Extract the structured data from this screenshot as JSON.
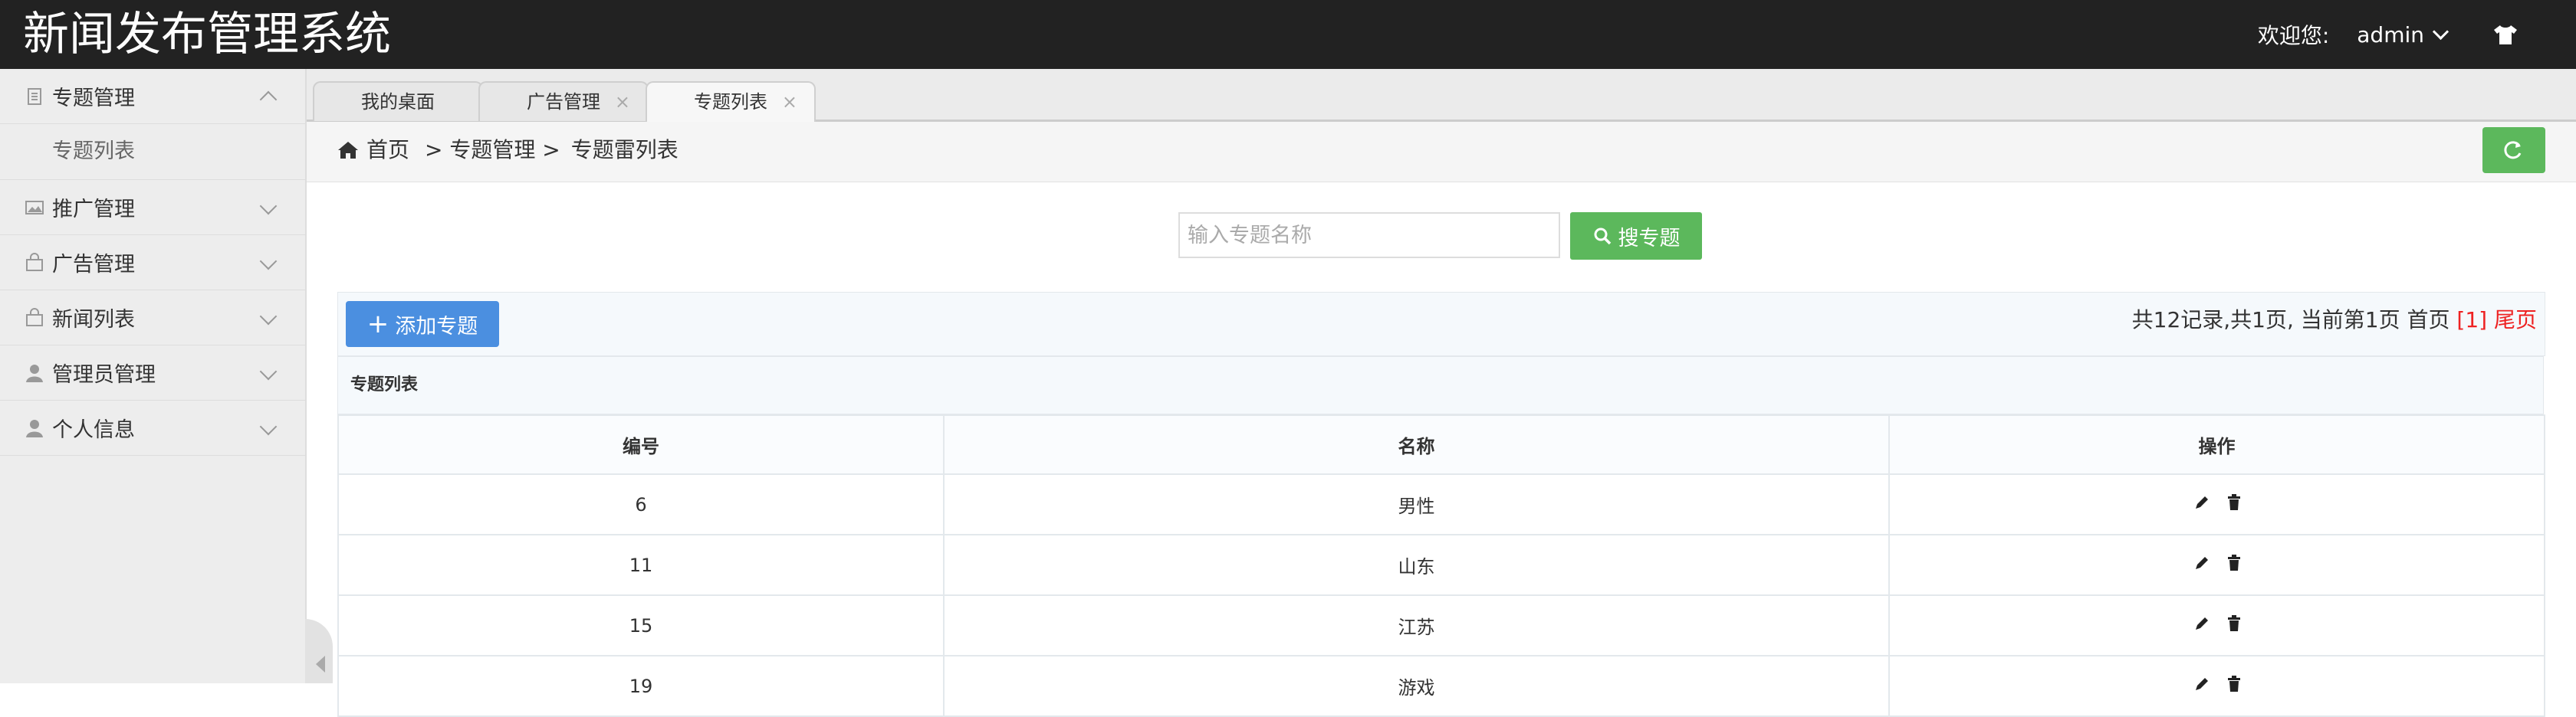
{
  "header": {
    "title": "新闻发布管理系统",
    "welcome": "欢迎您:",
    "user": "admin",
    "user_menu_icon": "chevron-down-icon",
    "theme_icon": "shirt-icon"
  },
  "sidebar": {
    "items": [
      {
        "label": "专题管理",
        "icon": "document-icon",
        "expanded": true,
        "children": [
          "专题列表"
        ]
      },
      {
        "label": "推广管理",
        "icon": "image-icon",
        "expanded": false
      },
      {
        "label": "广告管理",
        "icon": "bag-icon",
        "expanded": false
      },
      {
        "label": "新闻列表",
        "icon": "bag-icon",
        "expanded": false
      },
      {
        "label": "管理员管理",
        "icon": "user-icon",
        "expanded": false
      },
      {
        "label": "个人信息",
        "icon": "user-icon",
        "expanded": false
      }
    ]
  },
  "tabs": [
    {
      "label": "我的桌面",
      "closable": false
    },
    {
      "label": "广告管理",
      "closable": true,
      "close": "×"
    },
    {
      "label": "专题列表",
      "closable": true,
      "close": "×",
      "active": true
    }
  ],
  "breadcrumb": {
    "home": "首页",
    "level1": "> 专题管理 >",
    "level2": "专题雷列表"
  },
  "search": {
    "placeholder": "输入专题名称",
    "value": "",
    "button": "搜专题"
  },
  "toolbar": {
    "add_button": "添加专题",
    "pager_text": "共12记录,共1页, 当前第1页 首页",
    "pager_current": "[1]",
    "pager_last": "尾页"
  },
  "table": {
    "caption": "专题列表",
    "columns": [
      "编号",
      "名称",
      "操作"
    ],
    "rows": [
      {
        "id": "6",
        "name": "男性"
      },
      {
        "id": "11",
        "name": "山东"
      },
      {
        "id": "15",
        "name": "江苏"
      },
      {
        "id": "19",
        "name": "游戏"
      }
    ]
  },
  "colors": {
    "header_bg": "#222222",
    "success": "#5cb85c",
    "primary": "#4b8fe0",
    "danger": "#ee2222"
  }
}
